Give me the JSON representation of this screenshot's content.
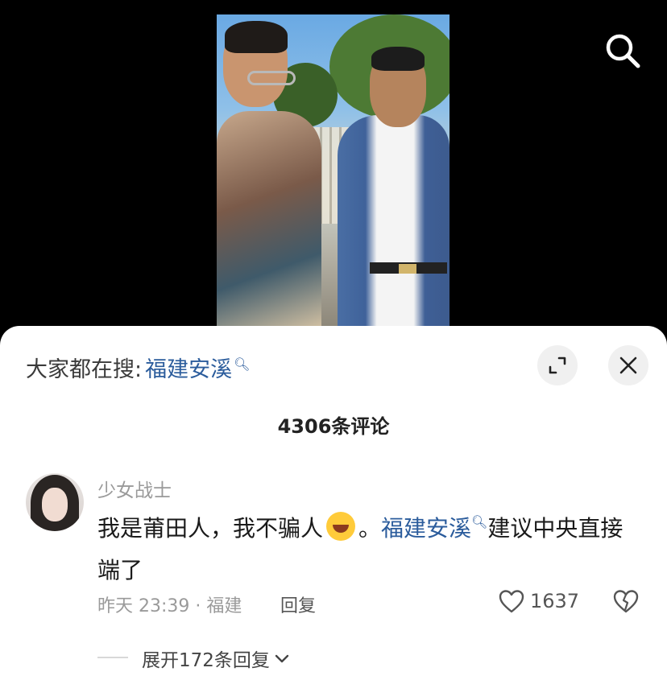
{
  "video": {
    "search_icon": "search-icon"
  },
  "sheet": {
    "hot_search_prefix": "大家都在搜:",
    "hot_search_keyword": "福建安溪",
    "expand_icon": "expand-icon",
    "close_icon": "close-icon",
    "comment_count": "4306条评论"
  },
  "comment": {
    "username": "少女战士",
    "text_part1": "我是莆田人，我不骗人",
    "emoji": "rofl-emoji",
    "text_part2": "。",
    "keyword": "福建安溪",
    "text_part3": "建议中央直接端了",
    "time_location": "昨天 23:39 · 福建",
    "reply_label": "回复",
    "like_count": "1637",
    "expand_replies": "展开172条回复"
  },
  "colors": {
    "link": "#2b5c9c",
    "muted": "#9a9a9a",
    "background": "#000000",
    "sheet": "#ffffff"
  }
}
